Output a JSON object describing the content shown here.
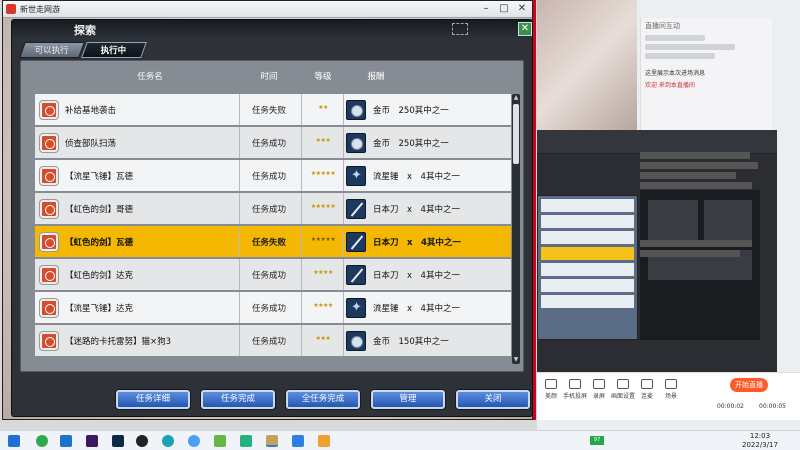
{
  "window": {
    "title": "新世走网游"
  },
  "panel": {
    "title": "探索",
    "tabs": [
      {
        "label": "可以执行",
        "active": false
      },
      {
        "label": "执行中",
        "active": true
      }
    ],
    "columns": [
      "任务名",
      "时间",
      "等级",
      "报酬"
    ],
    "rows": [
      {
        "name": "补给基地袭击",
        "status": "任务失败",
        "stars": "★★",
        "reward_icon": "coin",
        "reward": "金币　250其中之一",
        "selected": false
      },
      {
        "name": "侦查部队扫荡",
        "status": "任务成功",
        "stars": "★★★",
        "reward_icon": "coin",
        "reward": "金币　250其中之一",
        "selected": false
      },
      {
        "name": "【流星飞锤】瓦德",
        "status": "任务成功",
        "stars": "★★★★★",
        "reward_icon": "star",
        "reward": "流星锤　x　4其中之一",
        "selected": false
      },
      {
        "name": "【虹色的剑】哥德",
        "status": "任务成功",
        "stars": "★★★★★",
        "reward_icon": "blade",
        "reward": "日本刀　x　4其中之一",
        "selected": false
      },
      {
        "name": "【虹色的剑】瓦德",
        "status": "任务失败",
        "stars": "★★★★★",
        "reward_icon": "blade",
        "reward": "日本刀　x　4其中之一",
        "selected": true
      },
      {
        "name": "【虹色的剑】达克",
        "status": "任务成功",
        "stars": "★★★★",
        "reward_icon": "blade",
        "reward": "日本刀　x　4其中之一",
        "selected": false
      },
      {
        "name": "【流星飞锤】达克",
        "status": "任务成功",
        "stars": "★★★★",
        "reward_icon": "star",
        "reward": "流星锤　x　4其中之一",
        "selected": false
      },
      {
        "name": "【迷路的卡托雷努】猫×狗3",
        "status": "任务成功",
        "stars": "★★★",
        "reward_icon": "coin",
        "reward": "金币　150其中之一",
        "selected": false
      }
    ],
    "buttons": [
      "任务详细",
      "任务完成",
      "全任务完成",
      "管理",
      "关闭"
    ]
  },
  "background": {
    "chat_header": "直播间互动",
    "chat_messages": [
      "这里展示本次进场消息",
      "欢迎 来到本直播间"
    ],
    "tools": [
      "美颜",
      "手机投屏",
      "录屏",
      "画面设置",
      "连麦",
      "场景"
    ],
    "start_live": "开始直播",
    "time_left": "00:00:02",
    "time_right": "00:00:05"
  },
  "taskbar": {
    "time": "12:03",
    "date": "2022/3/17"
  },
  "colors": {
    "selected_row": "#f5b802",
    "button_blue": "#2357b3",
    "star_gold": "#c69500"
  }
}
